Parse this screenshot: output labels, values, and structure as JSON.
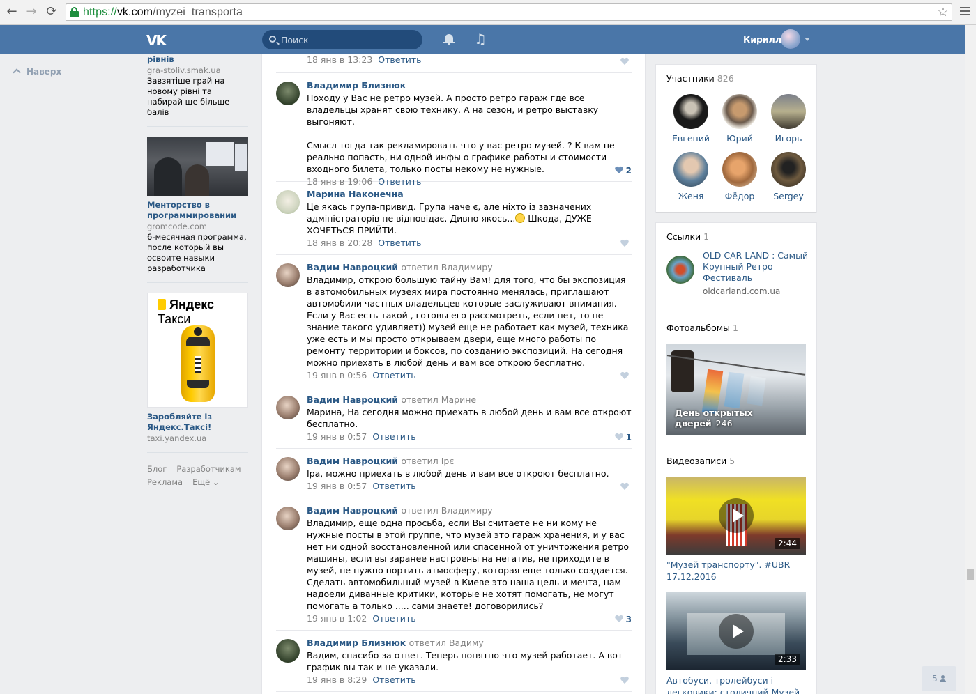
{
  "browser": {
    "url_scheme": "https://",
    "url_host": "vk.com",
    "url_path": "/myzei_transporta",
    "back_icon": "←",
    "forward_icon": "→",
    "reload_icon": "⟳",
    "star_icon": "☆"
  },
  "header": {
    "logo": "VK",
    "search_placeholder": "Поиск",
    "music_icon": "♫",
    "user_name": "Кирилл"
  },
  "left": {
    "up_label": "Наверх"
  },
  "ads": {
    "ad1": {
      "title": "рівнів",
      "domain": "gra-stoliv.smak.ua",
      "text": "Завзятіше грай на новому рівні та набирай ще більше балів"
    },
    "ad2": {
      "title": "Менторство в программировании",
      "domain": "gromcode.com",
      "text": "6-месячная программа, после который вы освоите навыки разработчика"
    },
    "ad3": {
      "logo_light": "Яндекс",
      "logo_bold": "Такси",
      "title": "Заробляйте із Яндекс.Таксі!",
      "domain": "taxi.yandex.ua"
    },
    "footer": [
      "Блог",
      "Разработчикам",
      "Реклама",
      "Ещё ⌄"
    ]
  },
  "comments": [
    {
      "author": "",
      "reply_to": "",
      "text": "",
      "date": "18 янв в 13:23",
      "reply_label": "Ответить",
      "likes": ""
    },
    {
      "author": "Владимир Близнюк",
      "reply_to": "",
      "text": "Походу у Вас не ретро музей. А просто ретро гараж где все владельцы хранят свою технику. А на сезон, и ретро выставку выгоняют.\n\nСмысл тогда так рекламировать что у вас ретро музей. ? К вам не реально попасть, ни одной инфы о графике работы и стоимости входного билета, только посты некому не нужные.",
      "date": "18 янв в 19:06",
      "reply_label": "Ответить",
      "likes": "2"
    },
    {
      "author": "Марина Наконечна",
      "reply_to": "",
      "text": "Це якась група-привид. Група наче є, але ніхто із зазначених адміністраторів не відповідає. Дивно якось...",
      "text_after_emoji": " Шкода, ДУЖЕ ХОЧЕТЬСЯ ПРИЙТИ.",
      "date": "18 янв в 20:28",
      "reply_label": "Ответить",
      "likes": ""
    },
    {
      "author": "Вадим Навроцкий",
      "reply_to": "ответил Владимиру",
      "text": "Владимир, открою большую тайну Вам! для того, что бы экспозиция в автомобильных музеях мира постоянно менялась, приглашают автомобили частных владельцев которые заслуживают внимания. Если у Вас есть такой , готовы его рассмотреть, если нет, то не знание такого удивляет)) музей еще не работает как музей, техника уже есть и мы просто открываем двери, еще много работы по ремонту территории и боксов, по созданию экспозиций. На сегодня можно приехать в любой день и вам все открою бесплатно.",
      "date": "19 янв в 0:56",
      "reply_label": "Ответить",
      "likes": ""
    },
    {
      "author": "Вадим Навроцкий",
      "reply_to": "ответил Марине",
      "text": "Марина, На сегодня можно приехать в любой день и вам все откроют бесплатно.",
      "date": "19 янв в 0:57",
      "reply_label": "Ответить",
      "likes": "1"
    },
    {
      "author": "Вадим Навроцкий",
      "reply_to": "ответил Ірє",
      "text": "Іра, можно приехать в любой день и вам все откроют бесплатно.",
      "date": "19 янв в 0:57",
      "reply_label": "Ответить",
      "likes": ""
    },
    {
      "author": "Вадим Навроцкий",
      "reply_to": "ответил Владимиру",
      "text": "Владимир, еще одна просьба, если Вы считаете не ни кому не нужные посты в этой группе, что музей это гараж хранения, и у вас нет ни одной восстановленной или спасенной от уничтожения ретро машины, если вы заранее настроены на негатив, не приходите в музей, не нужно портить атмосферу, которая еще только создается. Сделать автомобильный музей в Киеве это наша цель и мечта, нам надоели диванные критики, которые не хотят помогать, не могут помогать а только ..... сами знаете! договорились?",
      "date": "19 янв в 1:02",
      "reply_label": "Ответить",
      "likes": "3"
    },
    {
      "author": "Владимир Близнюк",
      "reply_to": "ответил Вадиму",
      "text": "Вадим, спасибо за ответ. Теперь понятно что музей работает. А вот график вы так и не указали.",
      "date": "19 янв в 8:29",
      "reply_label": "Ответить",
      "likes": ""
    }
  ],
  "sidebar": {
    "members": {
      "title": "Участники",
      "count": "826",
      "list": [
        "Евгений",
        "Юрий",
        "Игорь",
        "Женя",
        "Фёдор",
        "Sergey"
      ]
    },
    "links": {
      "title": "Ссылки",
      "count": "1",
      "item_title": "OLD CAR LAND : Самый Крупный Ретро Фестиваль",
      "item_domain": "oldcarland.com.ua"
    },
    "albums": {
      "title": "Фотоальбомы",
      "count": "1",
      "album_name": "День открытых дверей",
      "album_count": "246"
    },
    "videos": {
      "title": "Видеозаписи",
      "count": "5",
      "items": [
        {
          "duration": "2:44",
          "title": "\"Музей транспорту\". #UBR 17.12.2016"
        },
        {
          "duration": "2:33",
          "title": "Автобуси, тролейбуси і легковики: столичний Музей"
        }
      ]
    }
  },
  "chat": {
    "count": "5"
  }
}
